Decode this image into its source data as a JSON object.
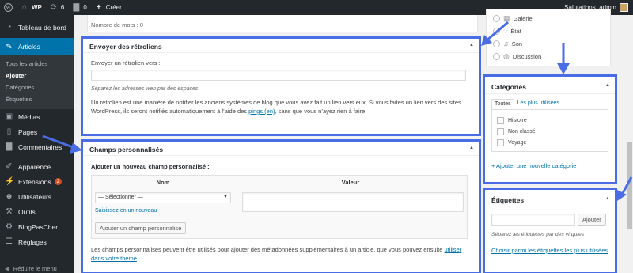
{
  "adminbar": {
    "site_name": "WP",
    "updates_count": "6",
    "comments_count": "0",
    "new_label": "Créer",
    "greeting": "Salutations, admin"
  },
  "sidebar": {
    "dashboard": "Tableau de bord",
    "articles": "Articles",
    "submenu": [
      "Tous les articles",
      "Ajouter",
      "Catégories",
      "Étiquettes"
    ],
    "media": "Médias",
    "pages": "Pages",
    "comments": "Commentaires",
    "appearance": "Apparence",
    "extensions": "Extensions",
    "extensions_badge": "2",
    "users": "Utilisateurs",
    "tools": "Outils",
    "blogpascher": "BlogPasCher",
    "settings": "Réglages",
    "collapse": "Réduire le menu"
  },
  "editor": {
    "word_count": "Nombre de mots : 0"
  },
  "trackbacks": {
    "title": "Envoyer des rétroliens",
    "field_label": "Envoyer un rétrolien vers :",
    "field_value": "",
    "hint": "Séparez les adresses web par des espaces",
    "desc_part1": "Un rétrolien est une manière de notifier les anciens systèmes de blog que vous avez fait un lien vers eux. Si vous faites un lien vers des sites WordPress, ils seront notifiés automatiquement à l’aide des ",
    "desc_link": "pings (en)",
    "desc_part2": ", sans que vous n’ayez rien à faire."
  },
  "custom_fields": {
    "title": "Champs personnalisés",
    "subtitle": "Ajouter un nouveau champ personnalisé :",
    "col_name": "Nom",
    "col_value": "Valeur",
    "select_value": "— Sélectionner —",
    "enter_new": "Saisissez-en un nouveau",
    "add_button": "Ajouter un champ personnalisé",
    "desc_part1": "Les champs personnalisés peuvent être utilisés pour ajouter des métadonnées supplémentaires à un article, que vous pouvez ensuite ",
    "desc_link": "utiliser dans votre thème",
    "desc_part2": "."
  },
  "formats": {
    "items": [
      "Galerie",
      "État",
      "Son",
      "Discussion"
    ]
  },
  "categories": {
    "title": "Catégories",
    "tab_all": "Toutes",
    "tab_popular": "Les plus utilisées",
    "items": [
      "Histoire",
      "Non classé",
      "Voyage"
    ],
    "add_link": "+ Ajouter une nouvelle catégorie"
  },
  "tags": {
    "title": "Étiquettes",
    "input_value": "",
    "add_button": "Ajouter",
    "hint": "Séparez les étiquettes par des virgules",
    "choose_link": "Choisir parmi les étiquettes les plus utilisées"
  },
  "colors": {
    "highlight": "#4a6de5",
    "admin_dark": "#23282d",
    "accent": "#0073aa",
    "badge": "#d54e21"
  }
}
